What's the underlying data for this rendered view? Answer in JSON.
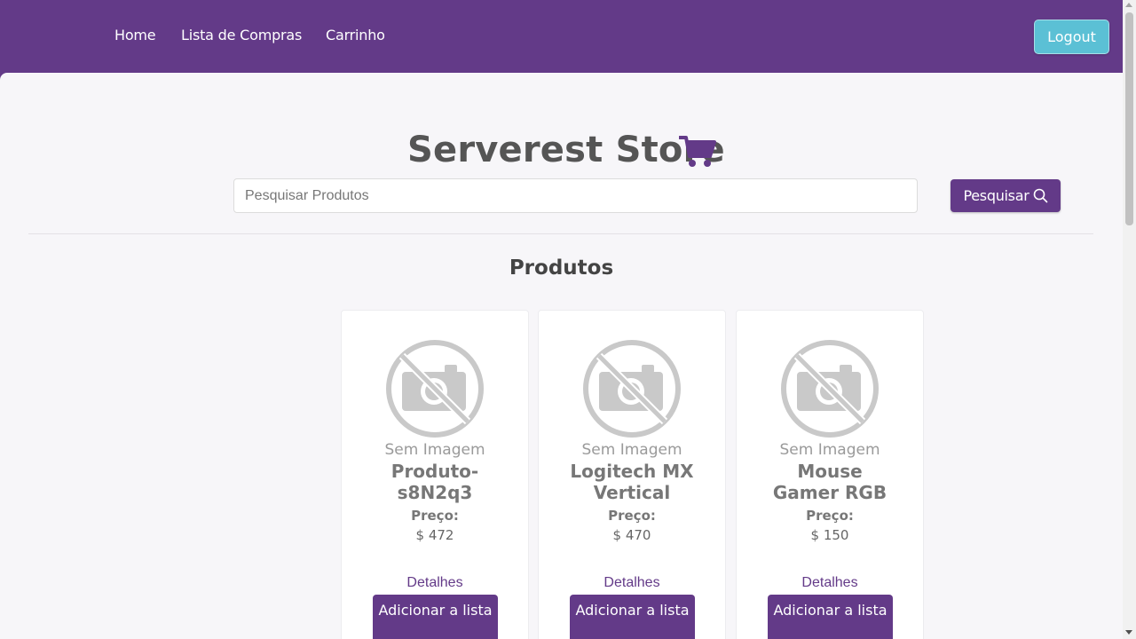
{
  "nav": {
    "items": [
      {
        "label": "Home"
      },
      {
        "label": "Lista de Compras"
      },
      {
        "label": "Carrinho"
      }
    ],
    "logout_label": "Logout"
  },
  "hero": {
    "title": "Serverest Store",
    "cart_icon": "shopping-cart-icon"
  },
  "search": {
    "placeholder": "Pesquisar Produtos",
    "value": "",
    "button_label": "Pesquisar",
    "button_icon": "search-icon"
  },
  "products_section": {
    "title": "Produtos",
    "cards": [
      {
        "image_text": "Sem Imagem",
        "name": "Produto-s8N2q3",
        "price_label": "Preço:",
        "price": "$ 472",
        "details_label": "Detalhes",
        "add_label": "Adicionar a lista"
      },
      {
        "image_text": "Sem Imagem",
        "name": "Logitech MX Vertical",
        "price_label": "Preço:",
        "price": "$ 470",
        "details_label": "Detalhes",
        "add_label": "Adicionar a lista"
      },
      {
        "image_text": "Sem Imagem",
        "name": "Mouse Gamer RGB",
        "price_label": "Preço:",
        "price": "$ 150",
        "details_label": "Detalhes",
        "add_label": "Adicionar a lista"
      }
    ]
  },
  "colors": {
    "brand": "#633a88",
    "logout": "#5bc0d5",
    "background": "#f7f6f9"
  }
}
